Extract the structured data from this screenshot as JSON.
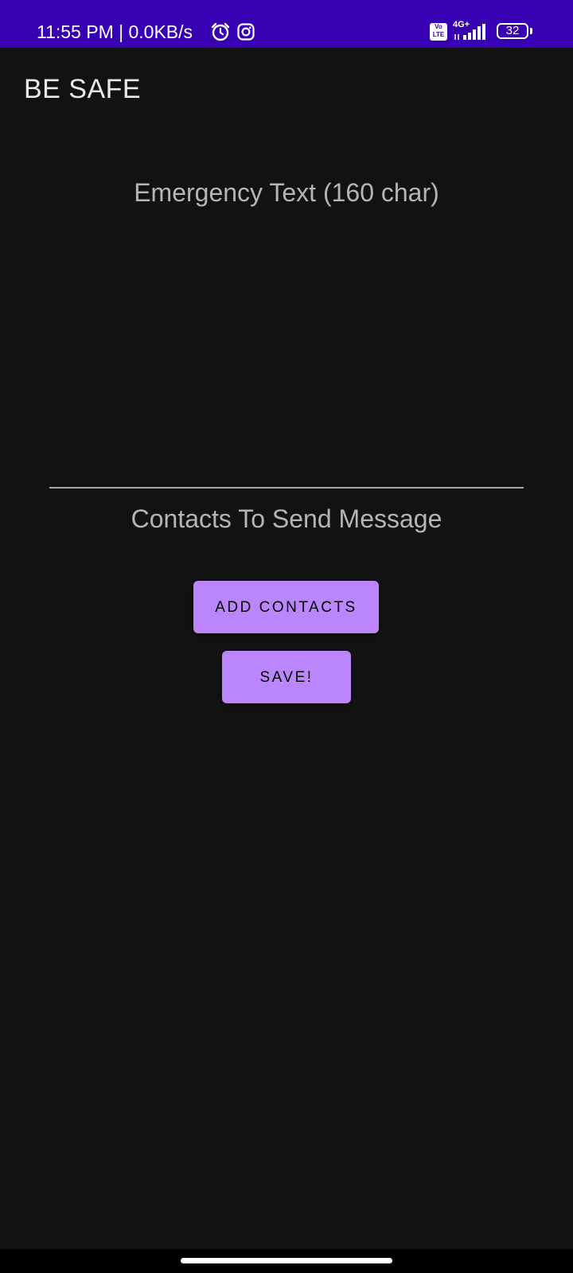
{
  "status_bar": {
    "time": "11:55 PM | 0.0KB/s",
    "volte_top": "Vo",
    "volte_bottom": "LTE",
    "network": "4G+",
    "battery_level": "32",
    "background_color": "#3700B3",
    "icons": [
      "alarm-icon",
      "instagram-icon",
      "volte-icon",
      "signal-icon",
      "battery-icon"
    ]
  },
  "app_bar": {
    "title": "BE SAFE"
  },
  "emergency_section": {
    "label": "Emergency Text (160 char)",
    "message_value": ""
  },
  "contacts_section": {
    "label": "Contacts To Send Message",
    "add_contacts_button": "ADD CONTACTS",
    "save_button": "SAVE!"
  },
  "theme": {
    "background": "#121212",
    "accent": "#BB86FC",
    "text_secondary": "#b5b5b5"
  }
}
